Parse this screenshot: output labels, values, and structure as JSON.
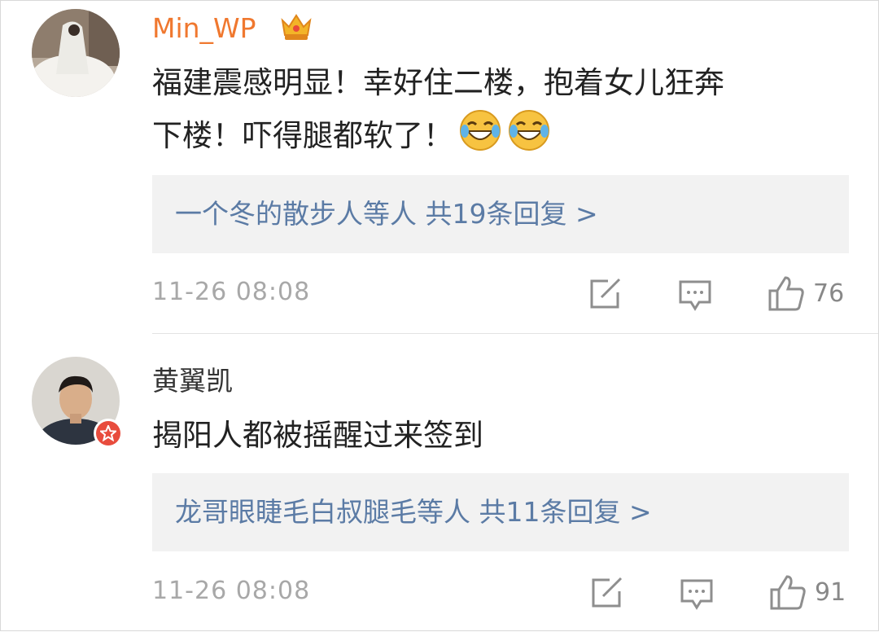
{
  "comments": [
    {
      "username": "Min_WP",
      "content_line1": "福建震感明显！幸好住二楼，抱着女儿狂奔",
      "content_line2": "下楼！吓得腿都软了！",
      "emojis": [
        "laugh-cry-icon",
        "laugh-cry-icon"
      ],
      "replies": {
        "names": "一个冬的散步人",
        "mid": "等人",
        "count": "共19条回复 >"
      },
      "timestamp": "11-26 08:08",
      "likes": "76"
    },
    {
      "username": "黄翼凯",
      "content_line1": "揭阳人都被摇醒过来签到",
      "replies": {
        "names": "龙哥眼睫毛白叔腿毛",
        "mid": "等人",
        "count": "共11条回复 >"
      },
      "timestamp": "11-26 08:08",
      "likes": "91"
    }
  ],
  "colors": {
    "vip_name": "#f0782f",
    "link": "#5b7ba5",
    "meta": "#a8a8a8",
    "reply_bg": "#f2f2f2",
    "verified": "#e84c3d"
  }
}
